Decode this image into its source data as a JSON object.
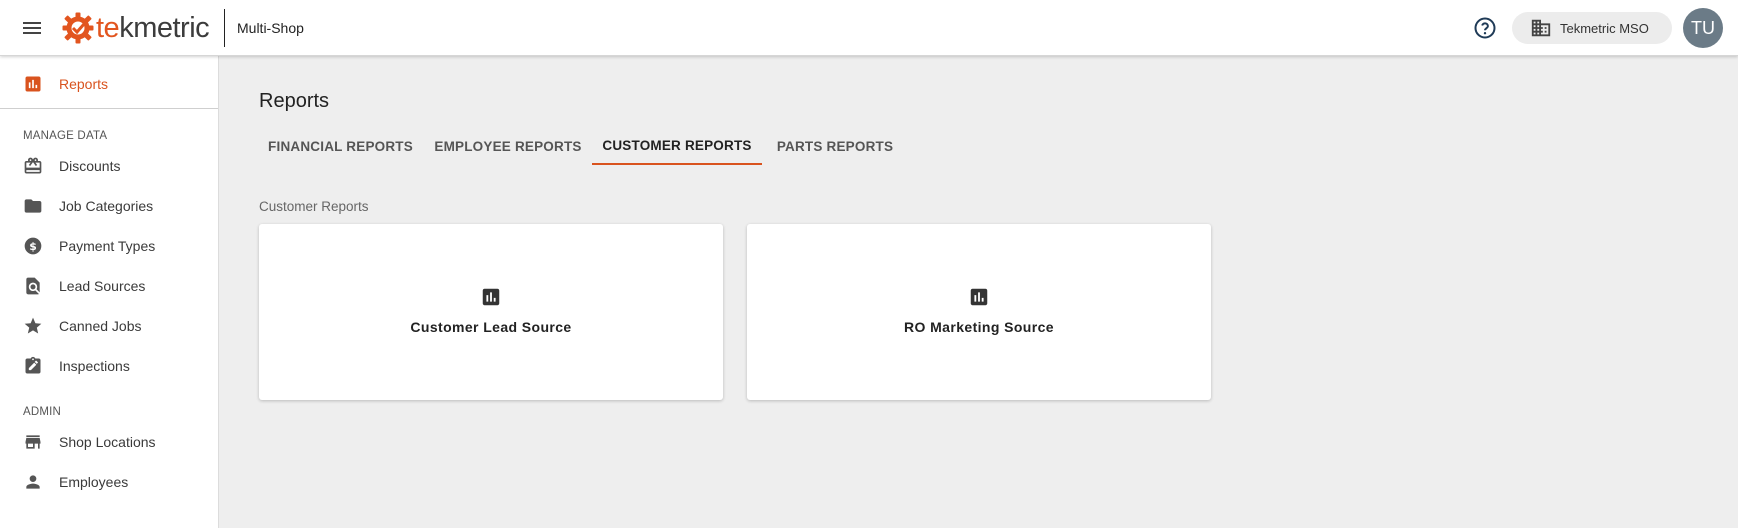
{
  "topbar": {
    "logo_text_accent": "te",
    "logo_text_rest": "kmetric",
    "shop_label": "Multi-Shop",
    "org_chip_label": "Tekmetric MSO",
    "avatar_initials": "TU"
  },
  "sidebar": {
    "reports_label": "Reports",
    "manage_data_heading": "MANAGE DATA",
    "manage_items": [
      {
        "label": "Discounts",
        "icon": "storefront-icon"
      },
      {
        "label": "Job Categories",
        "icon": "folder-icon"
      },
      {
        "label": "Payment Types",
        "icon": "dollar-circle-icon"
      },
      {
        "label": "Lead Sources",
        "icon": "search-document-icon"
      },
      {
        "label": "Canned Jobs",
        "icon": "star-icon"
      },
      {
        "label": "Inspections",
        "icon": "checklist-icon"
      }
    ],
    "admin_heading": "ADMIN",
    "admin_items": [
      {
        "label": "Shop Locations",
        "icon": "store-icon"
      },
      {
        "label": "Employees",
        "icon": "person-icon"
      }
    ]
  },
  "main": {
    "page_title": "Reports",
    "tabs": [
      {
        "label": "FINANCIAL REPORTS",
        "active": false
      },
      {
        "label": "EMPLOYEE REPORTS",
        "active": false
      },
      {
        "label": "CUSTOMER REPORTS",
        "active": true
      },
      {
        "label": "PARTS REPORTS",
        "active": false
      }
    ],
    "section_label": "Customer Reports",
    "cards": [
      {
        "title": "Customer Lead Source",
        "icon": "bar-chart-icon"
      },
      {
        "title": "RO Marketing Source",
        "icon": "bar-chart-icon"
      }
    ]
  },
  "colors": {
    "accent": "#d9531e",
    "background": "#eeeeee"
  }
}
